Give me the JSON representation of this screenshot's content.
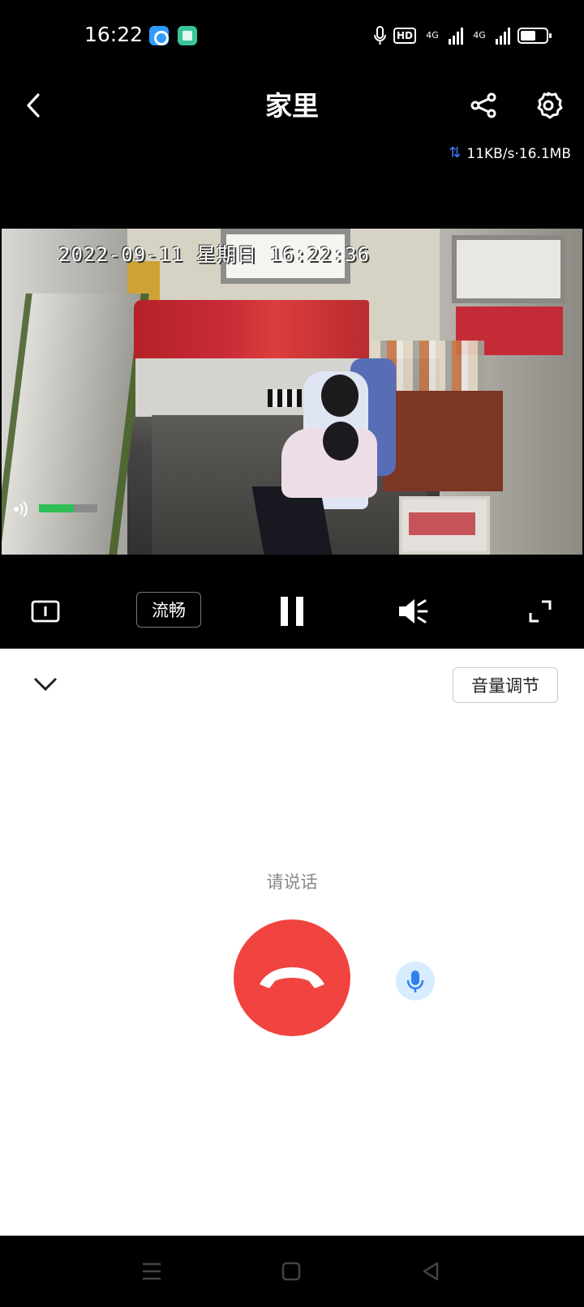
{
  "status_bar": {
    "time": "16:22",
    "network_1": "4G",
    "network_2": "4G",
    "hd_label": "HD",
    "battery_level": 0.55
  },
  "header": {
    "title": "家里",
    "traffic": "11KB/s·16.1MB"
  },
  "video": {
    "timestamp": "2022-09-11 星期日 16:22:36",
    "audio_level": 0.6
  },
  "controls": {
    "quality_label": "流畅"
  },
  "talk_panel": {
    "volume_button": "音量调节",
    "prompt": "请说话"
  },
  "colors": {
    "hangup": "#f1433f",
    "mic_bg": "#d7ecff",
    "mic_icon": "#2f80ed",
    "audio_meter": "#2fbf54",
    "traffic_icon": "#3f7cff"
  },
  "icons": {
    "back": "chevron-left-icon",
    "share": "share-icon",
    "settings": "gear-icon",
    "info": "info-icon",
    "pause": "pause-icon",
    "mute": "speaker-mute-icon",
    "fullscreen": "fullscreen-icon",
    "collapse": "chevron-down-icon",
    "hangup": "phone-hangup-icon",
    "mic": "microphone-icon"
  }
}
